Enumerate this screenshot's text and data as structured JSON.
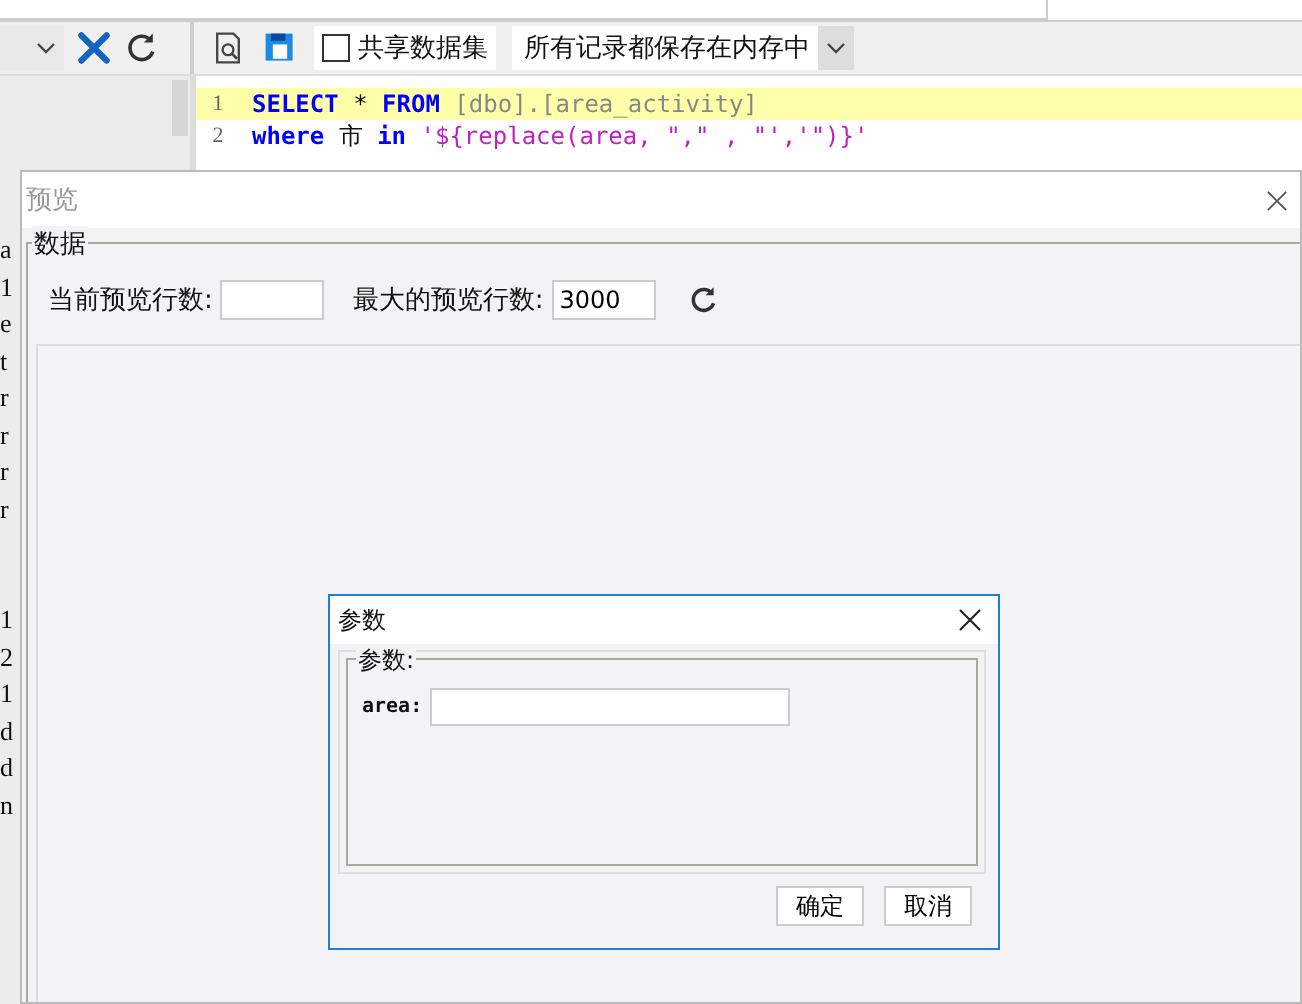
{
  "toolbar": {
    "share_dataset": {
      "label": "共享数据集",
      "checked": false
    },
    "storage_mode": {
      "value": "所有记录都保存在内存中"
    }
  },
  "editor": {
    "lines": [
      {
        "number": "1",
        "highlighted": true,
        "tokens": [
          {
            "kind": "keyword",
            "text": "SELECT"
          },
          {
            "kind": "plain",
            "text": " * "
          },
          {
            "kind": "keyword",
            "text": "FROM"
          },
          {
            "kind": "identifier",
            "text": " [dbo].[area_activity]"
          }
        ]
      },
      {
        "number": "2",
        "highlighted": false,
        "tokens": [
          {
            "kind": "keyword",
            "text": "where"
          },
          {
            "kind": "plain",
            "text": " 市 "
          },
          {
            "kind": "keyword",
            "text": "in"
          },
          {
            "kind": "string",
            "text": " '${replace(area, \",\" , \"','\")}'"
          }
        ]
      }
    ]
  },
  "left_fragments_upper": [
    "a",
    "1",
    "e",
    "t",
    "r",
    "r",
    "r",
    "r"
  ],
  "left_fragments_lower": [
    "1",
    "2",
    "1",
    "d",
    "d",
    "n"
  ],
  "preview_window": {
    "title": "预览",
    "group_title": "数据",
    "current_rows_label": "当前预览行数:",
    "max_rows_label": "最大的预览行数:",
    "max_rows_value": "3000"
  },
  "param_dialog": {
    "title": "参数",
    "group_title": "参数:",
    "fields": [
      {
        "label": "area:"
      }
    ],
    "buttons": [
      "确定",
      "取消"
    ]
  }
}
